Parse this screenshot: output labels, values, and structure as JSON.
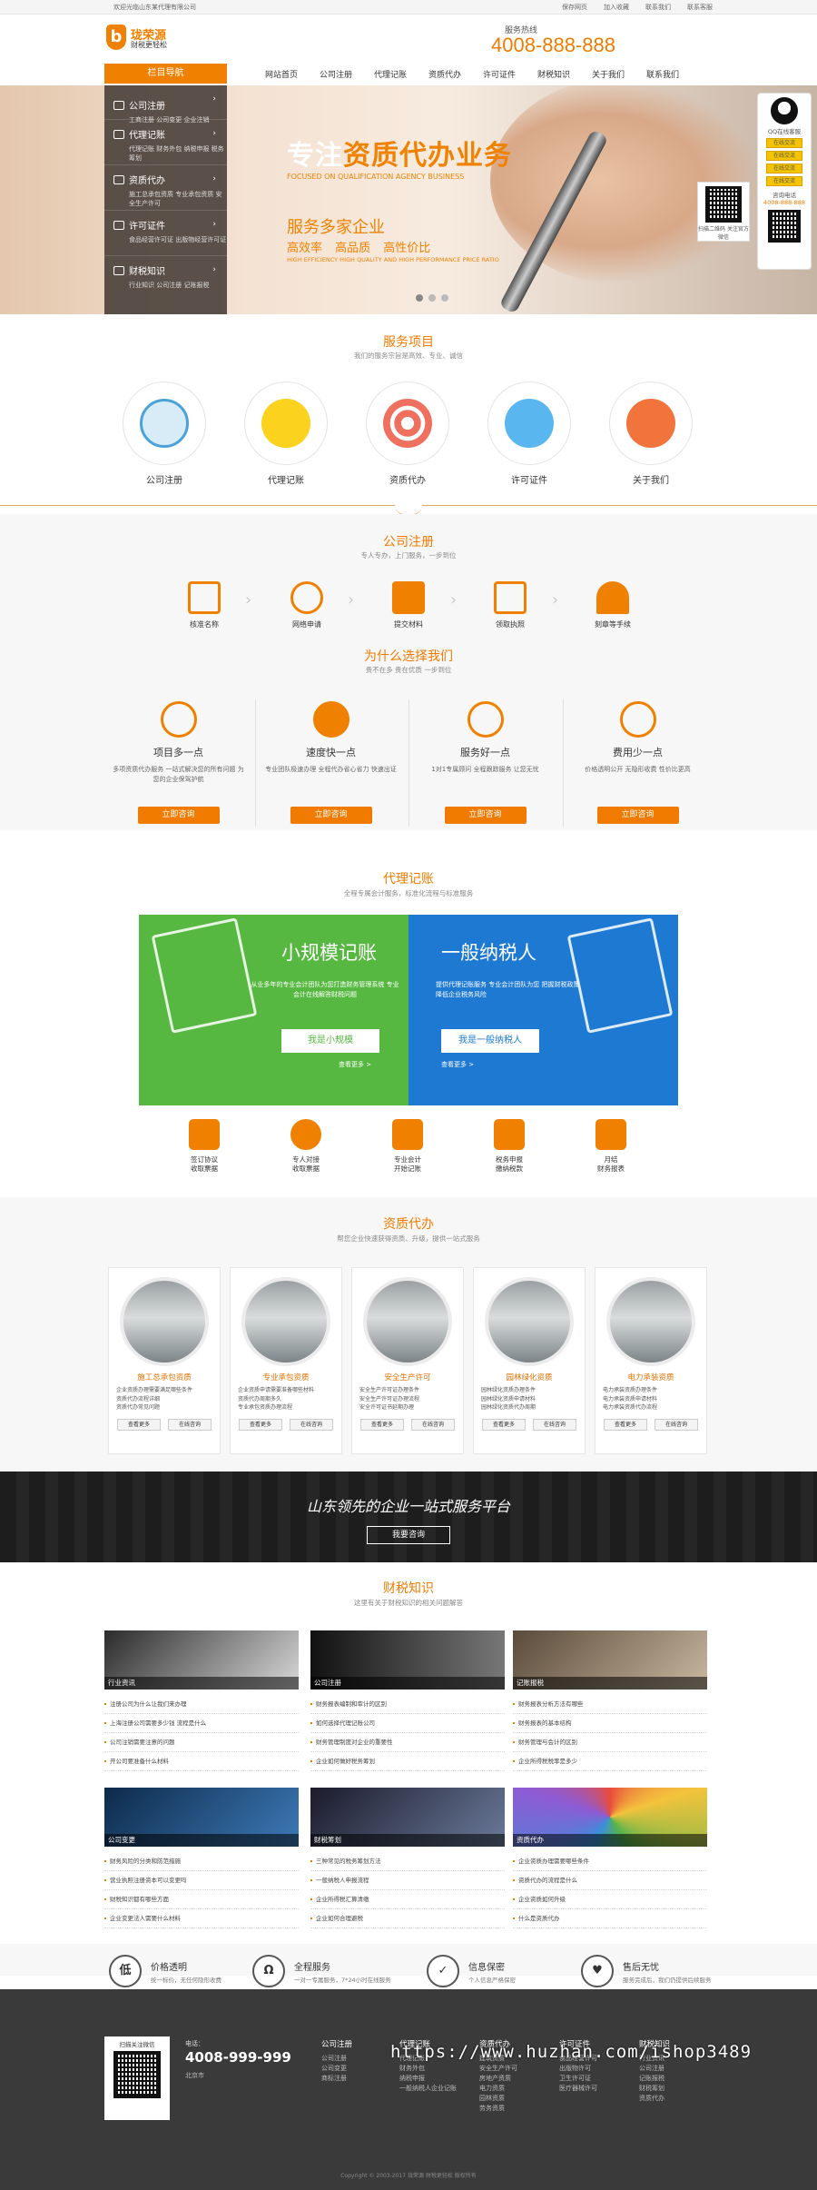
{
  "topbar": {
    "left": "欢迎光临山东某代理有限公司",
    "links": [
      "保存网页",
      "加入收藏",
      "联系我们",
      "联系客服"
    ]
  },
  "brand": {
    "name": "珑荣源",
    "slogan": "财税更轻松",
    "hotline_label": "服务热线",
    "hotline": "4008-888-888"
  },
  "nav": {
    "category": "栏目导航",
    "items": [
      "网站首页",
      "公司注册",
      "代理记账",
      "资质代办",
      "许可证件",
      "财税知识",
      "关于我们",
      "联系我们"
    ]
  },
  "sidemenu": [
    {
      "title": "公司注册",
      "sub": "工商注册 公司变更 企业注销"
    },
    {
      "title": "代理记账",
      "sub": "代理记账 财务外包 纳税申报 税务筹划"
    },
    {
      "title": "资质代办",
      "sub": "施工总承包资质 专业承包资质 安全生产许可"
    },
    {
      "title": "许可证件",
      "sub": "食品经营许可证 出版物经营许可证"
    },
    {
      "title": "财税知识",
      "sub": "行业知识 公司注册 记账报税"
    }
  ],
  "banner": {
    "title_white": "专注",
    "title_orange": "资质代办业务",
    "en1": "FOCUSED ON QUALIFICATION AGENCY BUSINESS",
    "sub": "服务多家企业",
    "features": "高效率 高品质 高性价比",
    "en2": "HIGH EFFICIENCY HIGH QUALITY AND HIGH PERFORMANCE PRICE RATIO"
  },
  "qq": {
    "title": "QQ在线客服",
    "buttons": [
      "在线交流",
      "在线交流",
      "在线交流",
      "在线交流"
    ],
    "consult": "咨询电话",
    "phone": "4008-888-888",
    "qr_caption": "扫描二维码 关注官方微信"
  },
  "services": {
    "title": "服务项目",
    "sub": "我们的服务宗旨是高效、专业、诚信",
    "items": [
      "公司注册",
      "代理记账",
      "资质代办",
      "许可证件",
      "关于我们"
    ]
  },
  "register": {
    "title": "公司注册",
    "sub": "专人专办，上门服务，一步到位",
    "steps": [
      "核准名称",
      "网络申请",
      "提交材料",
      "领取执照",
      "刻章等手续"
    ]
  },
  "why": {
    "title": "为什么选择我们",
    "sub": "贵不在多 贵在优质 一步到位",
    "items": [
      {
        "h": "项目多一点",
        "d": "多项资质代办服务 一站式解决您的所有问题 为您的企业保驾护航",
        "b": "立即咨询"
      },
      {
        "h": "速度快一点",
        "d": "专业团队极速办理 全程代办省心省力 快速出证",
        "b": "立即咨询"
      },
      {
        "h": "服务好一点",
        "d": "1对1专属顾问 全程跟踪服务 让您无忧",
        "b": "立即咨询"
      },
      {
        "h": "费用少一点",
        "d": "价格透明公开 无隐形收费 性价比更高",
        "b": "立即咨询"
      }
    ]
  },
  "accounting": {
    "title": "代理记账",
    "sub": "全程专属会计服务，标准化流程与标准服务",
    "small": {
      "h": "小规模记账",
      "d": "从业多年的专业会计团队为您打造财务管理系统 专业会计在线解答财税问题",
      "btn": "我是小规模",
      "more": "查看更多 >"
    },
    "general": {
      "h": "一般纳税人",
      "d": "提供代理记账服务 专业会计团队为您 把握财税政策 降低企业税务风险",
      "btn": "我是一般纳税人",
      "more": "查看更多 >"
    },
    "flow": [
      [
        "签订协议",
        "收取票据"
      ],
      [
        "专人对接",
        "收取票据"
      ],
      [
        "专业会计",
        "开始记账"
      ],
      [
        "税务申报",
        "缴纳税款"
      ],
      [
        "月结",
        "财务报表"
      ]
    ]
  },
  "qualification": {
    "title": "资质代办",
    "sub": "帮您企业快速获得资质、升级，提供一站式服务",
    "cards": [
      {
        "t": "施工总承包资质",
        "l": [
          "企业资质办理需要满足哪些条件",
          "资质代办流程详细",
          "资质代办常见问题"
        ],
        "b": [
          "查看更多",
          "在线咨询"
        ]
      },
      {
        "t": "专业承包资质",
        "l": [
          "企业资质申请需要准备哪些材料",
          "资质代办周期多久",
          "专业承包资质办理流程"
        ],
        "b": [
          "查看更多",
          "在线咨询"
        ]
      },
      {
        "t": "安全生产许可",
        "l": [
          "安全生产许可证办理条件",
          "安全生产许可证办理流程",
          "安全许可证书延期办理"
        ],
        "b": [
          "查看更多",
          "在线咨询"
        ]
      },
      {
        "t": "园林绿化资质",
        "l": [
          "园林绿化资质办理条件",
          "园林绿化资质申请材料",
          "园林绿化资质代办周期"
        ],
        "b": [
          "查看更多",
          "在线咨询"
        ]
      },
      {
        "t": "电力承装资质",
        "l": [
          "电力承装资质办理条件",
          "电力承装资质申请材料",
          "电力承装资质代办流程"
        ],
        "b": [
          "查看更多",
          "在线咨询"
        ]
      }
    ]
  },
  "band": {
    "title": "山东领先的企业一站式服务平台",
    "btn": "我要咨询"
  },
  "knowledge": {
    "title": "财税知识",
    "sub": "这里有关于财税知识的相关问题解答",
    "blocks": [
      {
        "cap": "行业资讯",
        "items": [
          "注册公司为什么让我们来办理",
          "上海注册公司需要多少钱 流程是什么",
          "公司注销需要注意的问题",
          "开公司要准备什么材料"
        ]
      },
      {
        "cap": "公司注册",
        "items": [
          "财务报表编制和审计的区别",
          "如何选择代理记账公司",
          "财务管理制度对企业的重要性",
          "企业如何做好税务筹划"
        ]
      },
      {
        "cap": "记账报税",
        "items": [
          "财务报表分析方法有哪些",
          "财务报表的基本结构",
          "财务管理与会计的区别",
          "企业所得税税率是多少"
        ]
      },
      {
        "cap": "公司变更",
        "items": [
          "财务风险的分类和防范措施",
          "营业执照注册资本可以变更吗",
          "财税知识都有哪些方面",
          "企业变更法人需要什么材料"
        ]
      },
      {
        "cap": "财税筹划",
        "items": [
          "三种常见的税务筹划方法",
          "一般纳税人申报流程",
          "企业所得税汇算清缴",
          "企业如何合理避税"
        ]
      },
      {
        "cap": "资质代办",
        "items": [
          "企业资质办理需要哪些条件",
          "资质代办的流程是什么",
          "企业资质如何升级",
          "什么是资质代办"
        ]
      }
    ]
  },
  "features": [
    {
      "ic": "低",
      "h": "价格透明",
      "d": "统一标价，无任何隐形收费"
    },
    {
      "ic": "Ω",
      "h": "全程服务",
      "d": "一对一专属服务，7*24小时在线服务"
    },
    {
      "ic": "✓",
      "h": "信息保密",
      "d": "个人信息严格保密"
    },
    {
      "ic": "♥",
      "h": "售后无忧",
      "d": "服务完成后，我们仍提供后续服务"
    }
  ],
  "footer": {
    "qr_caption": "扫描关注微信",
    "phone_label": "电话：",
    "phone": "4008-999-999",
    "address": "北京市",
    "cols": [
      {
        "h": "公司注册",
        "items": [
          "公司注册",
          "公司变更",
          "商标注册"
        ]
      },
      {
        "h": "代理记账",
        "items": [
          "代理记账",
          "财务外包",
          "纳税申报",
          "一般纳税人企业记账"
        ]
      },
      {
        "h": "资质代办",
        "items": [
          "建筑资质",
          "安全生产许可",
          "房地产资质",
          "电力资质",
          "园林资质",
          "劳务资质"
        ]
      },
      {
        "h": "许可证件",
        "items": [
          "食品经营许可",
          "出版物许可",
          "卫生许可证",
          "医疗器械许可"
        ]
      },
      {
        "h": "财税知识",
        "items": [
          "行业资讯",
          "公司注册",
          "记账报税",
          "财税筹划",
          "资质代办"
        ]
      }
    ],
    "copyright": "Copyright © 2003-2017 珑荣源 财税更轻松 版权所有"
  },
  "watermark": "https://www.huzhan.com/ishop3489",
  "colors": {
    "accent": "#f07b00",
    "green": "#57b841",
    "blue": "#1e79d3",
    "dark": "#3a3a3a"
  }
}
